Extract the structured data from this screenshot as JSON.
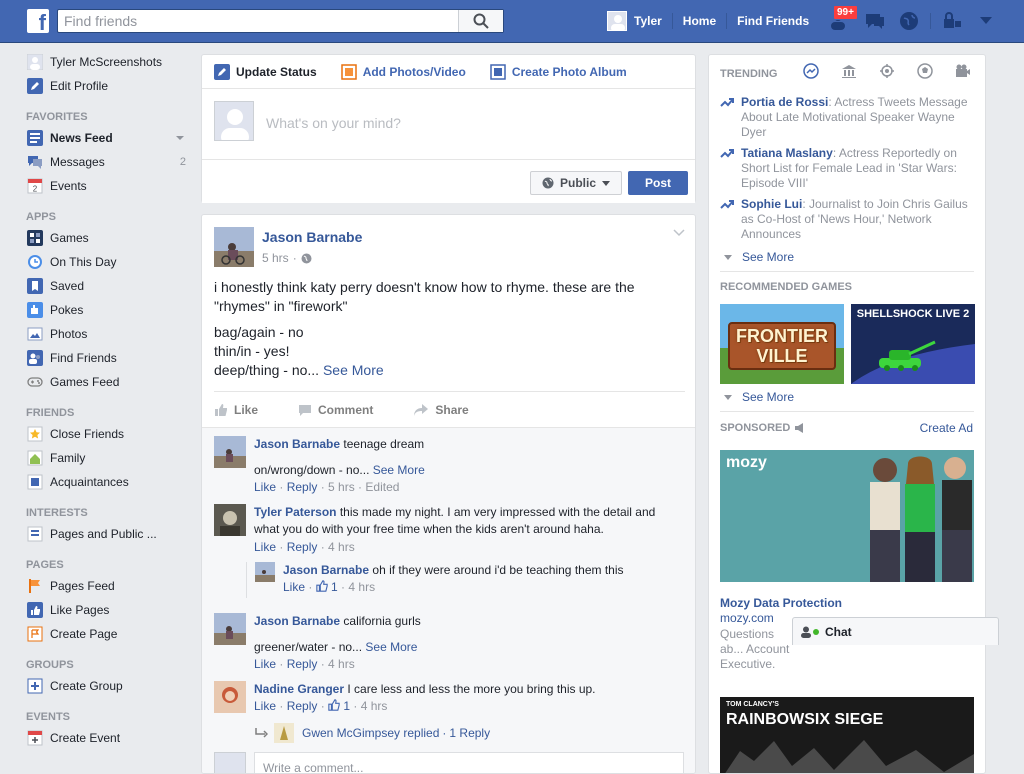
{
  "topbar": {
    "search_placeholder": "Find friends",
    "user_name": "Tyler",
    "home_label": "Home",
    "find_friends_label": "Find Friends",
    "friend_requests_badge": "99+",
    "brand_color": "#4267b2"
  },
  "sidebar": {
    "profile_name": "Tyler McScreenshots",
    "edit_profile": "Edit Profile",
    "sections": {
      "favorites": "FAVORITES",
      "apps": "APPS",
      "friends": "FRIENDS",
      "interests": "INTERESTS",
      "pages": "PAGES",
      "groups": "GROUPS",
      "events": "EVENTS"
    },
    "favorites": [
      {
        "label": "News Feed",
        "icon": "news-feed-icon"
      },
      {
        "label": "Messages",
        "count": "2",
        "icon": "messages-icon"
      },
      {
        "label": "Events",
        "icon": "calendar-icon",
        "icon_text": "2"
      }
    ],
    "apps": [
      {
        "label": "Games",
        "icon": "games-icon"
      },
      {
        "label": "On This Day",
        "icon": "clock-icon"
      },
      {
        "label": "Saved",
        "icon": "bookmark-icon"
      },
      {
        "label": "Pokes",
        "icon": "poke-icon"
      },
      {
        "label": "Photos",
        "icon": "photos-icon"
      },
      {
        "label": "Find Friends",
        "icon": "find-friends-icon"
      },
      {
        "label": "Games Feed",
        "icon": "gamepad-icon"
      }
    ],
    "friends": [
      {
        "label": "Close Friends",
        "icon": "star-icon"
      },
      {
        "label": "Family",
        "icon": "family-icon"
      },
      {
        "label": "Acquaintances",
        "icon": "acquaintances-icon"
      }
    ],
    "interests": [
      {
        "label": "Pages and Public ...",
        "icon": "pages-icon"
      }
    ],
    "pages": [
      {
        "label": "Pages Feed",
        "icon": "flag-icon"
      },
      {
        "label": "Like Pages",
        "icon": "thumbs-up-icon"
      },
      {
        "label": "Create Page",
        "icon": "create-page-icon"
      }
    ],
    "groups": [
      {
        "label": "Create Group",
        "icon": "plus-icon"
      }
    ],
    "events": [
      {
        "label": "Create Event",
        "icon": "calendar-plus-icon"
      }
    ]
  },
  "composer": {
    "tab_update": "Update Status",
    "tab_photos": "Add Photos/Video",
    "tab_album": "Create Photo Album",
    "placeholder": "What's on your mind?",
    "privacy": "Public",
    "post": "Post"
  },
  "post": {
    "author": "Jason Barnabe",
    "time": "5 hrs",
    "text_line1": "i honestly think katy perry doesn't know how to rhyme. these are the \"rhymes\" in \"firework\"",
    "text_line2": "bag/again - no",
    "text_line3": "thin/in - yes!",
    "text_line4": "deep/thing - no...",
    "see_more": "See More",
    "actions": {
      "like": "Like",
      "comment": "Comment",
      "share": "Share"
    }
  },
  "comments": [
    {
      "author": "Jason Barnabe",
      "text": "teenage dream",
      "text2": "on/wrong/down - no...",
      "see_more": "See More",
      "like": "Like",
      "reply": "Reply",
      "meta": "5 hrs · Edited"
    },
    {
      "author": "Tyler Paterson",
      "text": "this made my night. I am very impressed with the detail and what you do with your free time when the kids aren't around haha.",
      "like": "Like",
      "reply": "Reply",
      "meta": "4 hrs"
    },
    {
      "author": "Jason Barnabe",
      "text": "oh if they were around i'd be teaching them this",
      "like": "Like",
      "likes": "1",
      "meta": "4 hrs"
    },
    {
      "author": "Jason Barnabe",
      "text": "california gurls",
      "text2": "greener/water - no...",
      "see_more": "See More",
      "like": "Like",
      "reply": "Reply",
      "meta": "4 hrs"
    },
    {
      "author": "Nadine Granger",
      "text": "I care less and less the more you bring this up.",
      "like": "Like",
      "reply": "Reply",
      "likes": "1",
      "meta": "4 hrs"
    },
    {
      "replied": "Gwen McGimpsey replied",
      "reply_count": "1 Reply"
    }
  ],
  "comment_input_placeholder": "Write a comment...",
  "right": {
    "trending_title": "TRENDING",
    "trending": [
      {
        "name": "Portia de Rossi",
        "desc": ": Actress Tweets Message About Late Motivational Speaker Wayne Dyer"
      },
      {
        "name": "Tatiana Maslany",
        "desc": ": Actress Reportedly on Short List for Female Lead in 'Star Wars: Episode VIII'"
      },
      {
        "name": "Sophie Lui",
        "desc": ": Journalist to Join Chris Gailus as Co-Host of 'News Hour,' Network Announces"
      }
    ],
    "see_more": "See More",
    "games_title": "RECOMMENDED GAMES",
    "game1": "FRONTIER VILLE",
    "game2": "SHELLSHOCK LIVE 2",
    "see_more2": "See More",
    "sponsored": "SPONSORED",
    "create_ad": "Create Ad",
    "ad_brand": "mozy",
    "ad_title": "Mozy Data Protection",
    "ad_url": "mozy.com",
    "ad_text": "Questions ab... Account Executive.",
    "ad2_brand": "TOM CLANCY'S",
    "ad2_title": "RAINBOWSIX SIEGE"
  },
  "chat": {
    "label": "Chat"
  }
}
